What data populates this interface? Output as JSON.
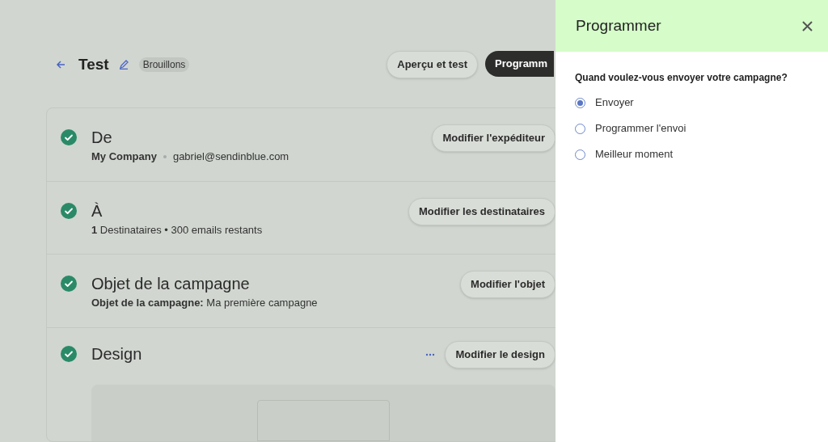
{
  "header": {
    "title": "Test",
    "badge": "Brouillons",
    "buttons": [
      {
        "label": "Aperçu et test",
        "kind": "secondary"
      },
      {
        "label": "Programm",
        "kind": "primary"
      }
    ]
  },
  "sections": [
    {
      "title": "De",
      "done": true,
      "kind": "sender",
      "name": "My Company",
      "detail": "gabriel@sendinblue.com",
      "button": "Modifier l'expéditeur"
    },
    {
      "title": "À",
      "done": true,
      "kind": "text",
      "detail": "**1** Destinataires • 300 emails restants",
      "button": "Modifier les destinataires"
    },
    {
      "title": "Objet de la campagne",
      "done": true,
      "kind": "text",
      "detail": "**Objet de la campagne:** Ma première campagne",
      "button": "Modifier l'objet"
    },
    {
      "title": "Design",
      "done": true,
      "kind": "design",
      "button": "Modifier le design"
    }
  ],
  "panel": {
    "title": "Programmer",
    "question": "Quand voulez-vous envoyer votre campagne?",
    "options": [
      {
        "label": "Envoyer",
        "selected": true
      },
      {
        "label": "Programmer l'envoi",
        "selected": false
      },
      {
        "label": "Meilleur moment",
        "selected": false
      }
    ]
  }
}
